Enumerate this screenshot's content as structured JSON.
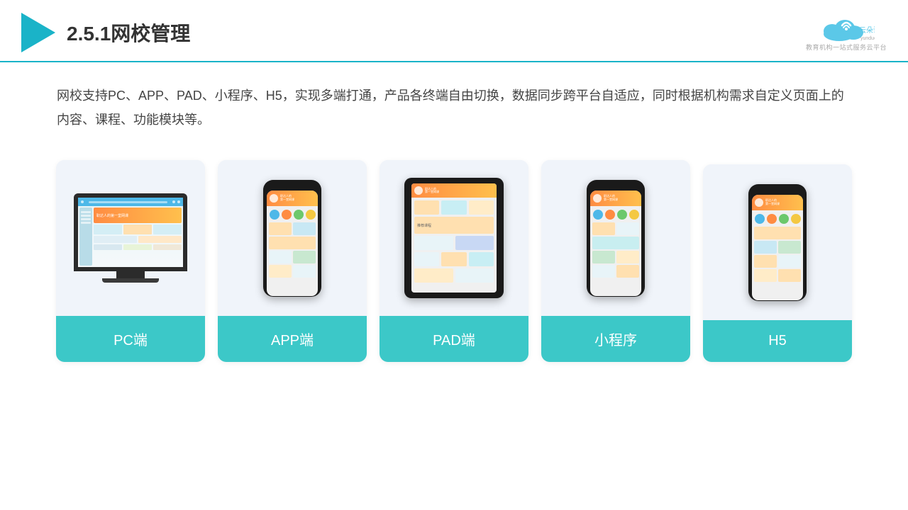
{
  "header": {
    "title": "2.5.1网校管理",
    "brand_name": "云朵课堂",
    "brand_url": "yunduoketang.com",
    "brand_tagline": "教育机构一站",
    "brand_sub": "式服务云平台"
  },
  "description": {
    "text": "网校支持PC、APP、PAD、小程序、H5，实现多端打通，产品各终端自由切换，数据同步跨平台自适应，同时根据机构需求自定义页面上的内容、课程、功能模块等。"
  },
  "cards": [
    {
      "id": "pc",
      "label": "PC端"
    },
    {
      "id": "app",
      "label": "APP端"
    },
    {
      "id": "pad",
      "label": "PAD端"
    },
    {
      "id": "miniapp",
      "label": "小程序"
    },
    {
      "id": "h5",
      "label": "H5"
    }
  ],
  "colors": {
    "accent": "#3cc8c8",
    "header_line": "#1ab3c8",
    "card_bg": "#f0f4fa"
  }
}
